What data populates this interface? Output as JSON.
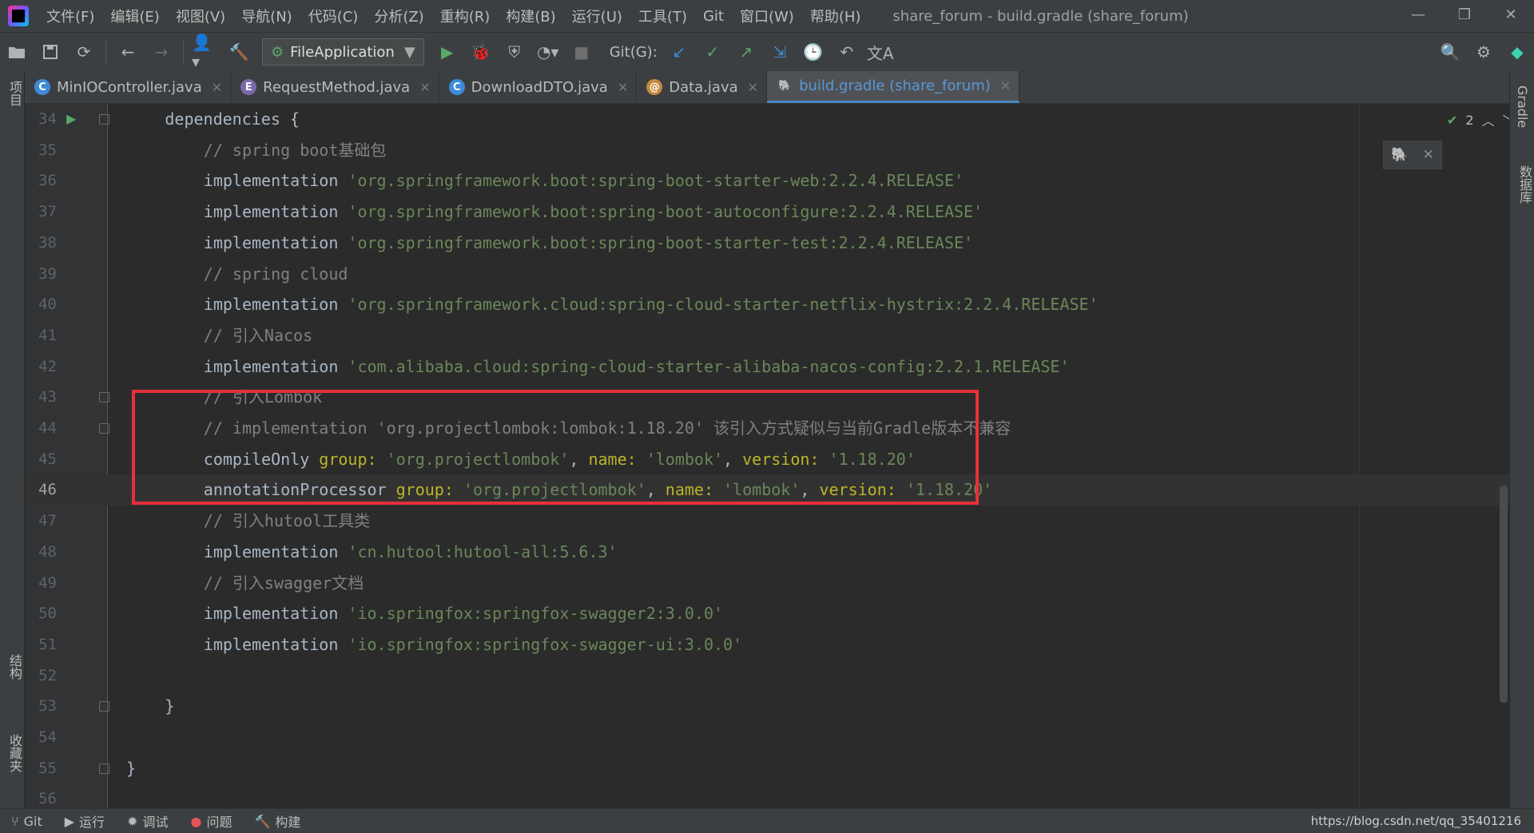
{
  "menubar": {
    "items": [
      "文件(F)",
      "编辑(E)",
      "视图(V)",
      "导航(N)",
      "代码(C)",
      "分析(Z)",
      "重构(R)",
      "构建(B)",
      "运行(U)",
      "工具(T)",
      "Git",
      "窗口(W)",
      "帮助(H)"
    ],
    "window_title": "share_forum - build.gradle (share_forum)"
  },
  "toolbar": {
    "run_config": "FileApplication",
    "git_label": "Git(G):"
  },
  "tabs": [
    {
      "label": "MinIOController.java",
      "icon": "C"
    },
    {
      "label": "RequestMethod.java",
      "icon": "E"
    },
    {
      "label": "DownloadDTO.java",
      "icon": "C"
    },
    {
      "label": "Data.java",
      "icon": "@"
    },
    {
      "label": "build.gradle (share_forum)",
      "icon": "gradle"
    }
  ],
  "side_panels": {
    "left_top": "项目",
    "left_structure": "结构",
    "left_favorites": "收藏夹",
    "right_gradle": "Gradle",
    "right_database": "数据库"
  },
  "inspection": {
    "count": "2"
  },
  "editor": {
    "current_line": 46,
    "lines": [
      {
        "n": "34",
        "tokens": [
          {
            "t": "plain",
            "s": "dependencies {"
          }
        ],
        "indent": 2
      },
      {
        "n": "35",
        "tokens": [
          {
            "t": "comment",
            "s": "// spring boot基础包"
          }
        ],
        "indent": 4
      },
      {
        "n": "36",
        "tokens": [
          {
            "t": "plain",
            "s": "implementation "
          },
          {
            "t": "string",
            "s": "'org.springframework.boot:spring-boot-starter-web:2.2.4.RELEASE'"
          }
        ],
        "indent": 4
      },
      {
        "n": "37",
        "tokens": [
          {
            "t": "plain",
            "s": "implementation "
          },
          {
            "t": "string",
            "s": "'org.springframework.boot:spring-boot-autoconfigure:2.2.4.RELEASE'"
          }
        ],
        "indent": 4
      },
      {
        "n": "38",
        "tokens": [
          {
            "t": "plain",
            "s": "implementation "
          },
          {
            "t": "string",
            "s": "'org.springframework.boot:spring-boot-starter-test:2.2.4.RELEASE'"
          }
        ],
        "indent": 4
      },
      {
        "n": "39",
        "tokens": [
          {
            "t": "comment",
            "s": "// spring cloud"
          }
        ],
        "indent": 4
      },
      {
        "n": "40",
        "tokens": [
          {
            "t": "plain",
            "s": "implementation "
          },
          {
            "t": "string",
            "s": "'org.springframework.cloud:spring-cloud-starter-netflix-hystrix:2.2.4.RELEASE'"
          }
        ],
        "indent": 4
      },
      {
        "n": "41",
        "tokens": [
          {
            "t": "comment",
            "s": "// 引入Nacos"
          }
        ],
        "indent": 4
      },
      {
        "n": "42",
        "tokens": [
          {
            "t": "plain",
            "s": "implementation "
          },
          {
            "t": "string",
            "s": "'com.alibaba.cloud:spring-cloud-starter-alibaba-nacos-config:2.2.1.RELEASE'"
          }
        ],
        "indent": 4
      },
      {
        "n": "43",
        "tokens": [
          {
            "t": "comment",
            "s": "// 引入Lombok"
          }
        ],
        "indent": 4
      },
      {
        "n": "44",
        "tokens": [
          {
            "t": "comment",
            "s": "// implementation 'org.projectlombok:lombok:1.18.20' 该引入方式疑似与当前Gradle版本不兼容"
          }
        ],
        "indent": 4
      },
      {
        "n": "45",
        "tokens": [
          {
            "t": "plain",
            "s": "compileOnly "
          },
          {
            "t": "named",
            "s": "group: "
          },
          {
            "t": "string",
            "s": "'org.projectlombok'"
          },
          {
            "t": "plain",
            "s": ", "
          },
          {
            "t": "named",
            "s": "name: "
          },
          {
            "t": "string",
            "s": "'lombok'"
          },
          {
            "t": "plain",
            "s": ", "
          },
          {
            "t": "named",
            "s": "version: "
          },
          {
            "t": "string",
            "s": "'1.18.20'"
          }
        ],
        "indent": 4
      },
      {
        "n": "46",
        "tokens": [
          {
            "t": "plain",
            "s": "annotationProcessor "
          },
          {
            "t": "named",
            "s": "group: "
          },
          {
            "t": "string",
            "s": "'org.projectlombok'"
          },
          {
            "t": "plain",
            "s": ", "
          },
          {
            "t": "named",
            "s": "name: "
          },
          {
            "t": "string",
            "s": "'lombok'"
          },
          {
            "t": "plain",
            "s": ", "
          },
          {
            "t": "named",
            "s": "version: "
          },
          {
            "t": "string",
            "s": "'1.18.20'"
          }
        ],
        "indent": 4
      },
      {
        "n": "47",
        "tokens": [
          {
            "t": "comment",
            "s": "// 引入hutool工具类"
          }
        ],
        "indent": 4
      },
      {
        "n": "48",
        "tokens": [
          {
            "t": "plain",
            "s": "implementation "
          },
          {
            "t": "string",
            "s": "'cn.hutool:hutool-all:5.6.3'"
          }
        ],
        "indent": 4
      },
      {
        "n": "49",
        "tokens": [
          {
            "t": "comment",
            "s": "// 引入swagger文档"
          }
        ],
        "indent": 4
      },
      {
        "n": "50",
        "tokens": [
          {
            "t": "plain",
            "s": "implementation "
          },
          {
            "t": "string",
            "s": "'io.springfox:springfox-swagger2:3.0.0'"
          }
        ],
        "indent": 4
      },
      {
        "n": "51",
        "tokens": [
          {
            "t": "plain",
            "s": "implementation "
          },
          {
            "t": "string",
            "s": "'io.springfox:springfox-swagger-ui:3.0.0'"
          }
        ],
        "indent": 4
      },
      {
        "n": "52",
        "tokens": [],
        "indent": 0
      },
      {
        "n": "53",
        "tokens": [
          {
            "t": "plain",
            "s": "}"
          }
        ],
        "indent": 2
      },
      {
        "n": "54",
        "tokens": [],
        "indent": 0
      },
      {
        "n": "55",
        "tokens": [
          {
            "t": "plain",
            "s": "}"
          }
        ],
        "indent": 0
      },
      {
        "n": "56",
        "tokens": [],
        "indent": 0
      }
    ]
  },
  "statusbar": {
    "git": "Git",
    "run": "运行",
    "debug": "调试",
    "problems": "问题",
    "build": "构建",
    "watermark": "https://blog.csdn.net/qq_35401216"
  },
  "colors": {
    "comment": "#808080",
    "string": "#6a8759",
    "named_arg": "#bbb529",
    "highlight_box": "#e8303a",
    "active_tab": "#4a88c7"
  }
}
